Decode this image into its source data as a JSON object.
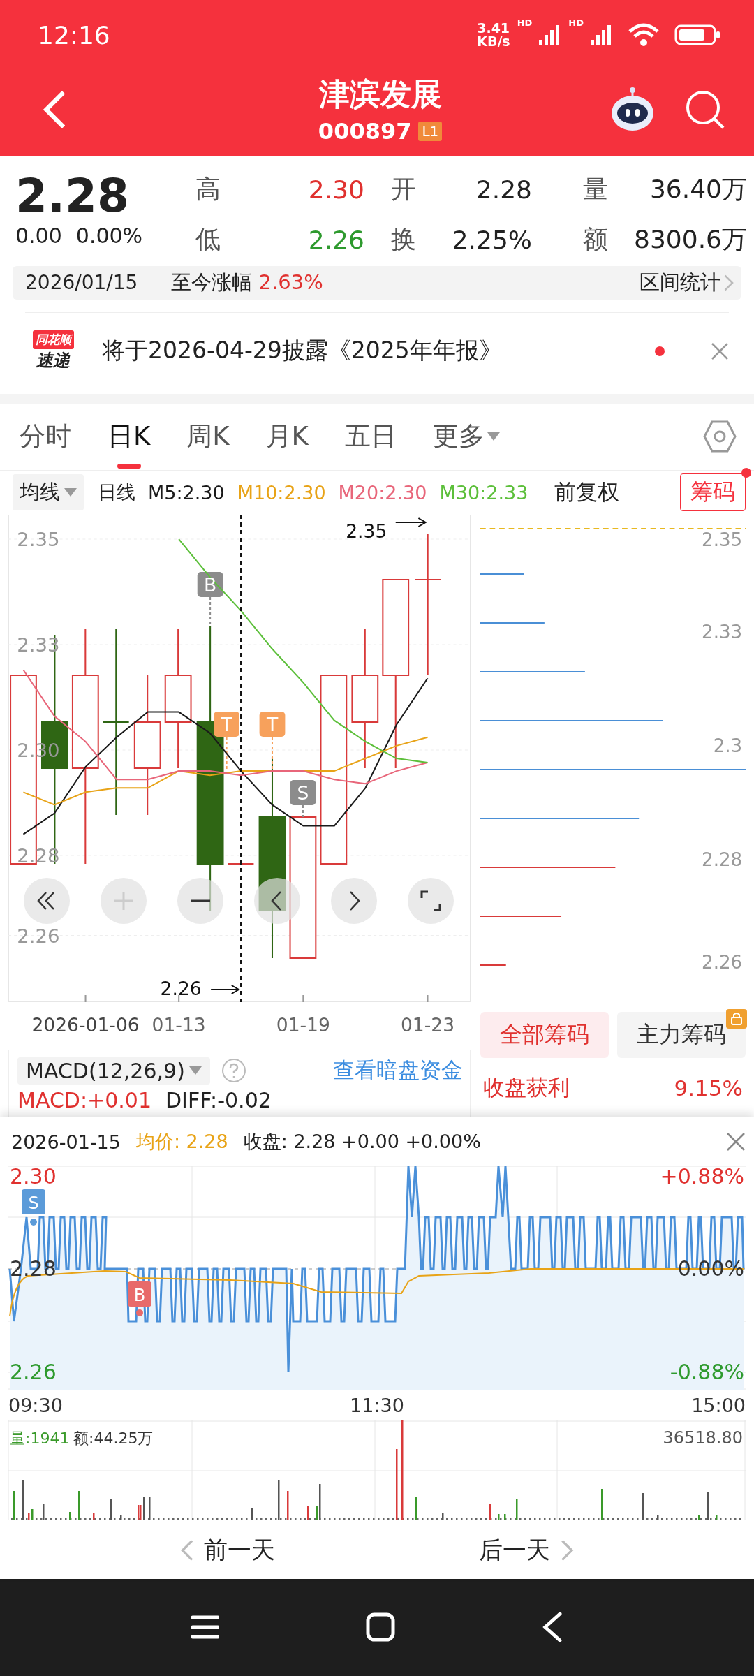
{
  "status_bar": {
    "time": "12:16",
    "speed_value": "3.41",
    "speed_unit": "KB/s",
    "signal_labels": [
      "HD",
      "HD"
    ]
  },
  "header": {
    "title": "津滨发展",
    "code": "000897",
    "level_badge": "L1"
  },
  "quote": {
    "price": "2.28",
    "change": "0.00",
    "change_pct": "0.00%",
    "stats": [
      {
        "label": "高",
        "value": "2.30",
        "color": "#e0312f"
      },
      {
        "label": "开",
        "value": "2.28",
        "color": "#222222"
      },
      {
        "label": "量",
        "value": "36.40万",
        "color": "#222222"
      },
      {
        "label": "低",
        "value": "2.26",
        "color": "#2e9a2e"
      },
      {
        "label": "换",
        "value": "2.25%",
        "color": "#222222"
      },
      {
        "label": "额",
        "value": "8300.6万",
        "color": "#222222"
      }
    ]
  },
  "range_bar": {
    "date": "2026/01/15",
    "label": "至今涨幅",
    "value": "2.63%",
    "link": "区间统计"
  },
  "notice": {
    "badge_top": "同花顺",
    "badge_bottom": "速递",
    "text": "将于2026-04-29披露《2025年年报》",
    "unread": true
  },
  "tabs": [
    {
      "label": "分时",
      "selected": false,
      "kind": "tab"
    },
    {
      "label": "日K",
      "selected": true,
      "kind": "tab"
    },
    {
      "label": "周K",
      "selected": false,
      "kind": "tab"
    },
    {
      "label": "月K",
      "selected": false,
      "kind": "tab"
    },
    {
      "label": "五日",
      "selected": false,
      "kind": "tab"
    },
    {
      "label": "更多",
      "selected": false,
      "kind": "menu"
    }
  ],
  "indicator_bar": {
    "selector": "均线",
    "period": "日线",
    "averages": [
      {
        "value": ":2.30"
      },
      {
        "value": ":2.30"
      },
      {
        "value": ":2.30"
      },
      {
        "value": ":2.33"
      }
    ],
    "adjust": "前复权",
    "chips_button": "筹码",
    "chips_new": true
  },
  "kline": {
    "chart_data": {
      "type": "line",
      "categories": [
        null,
        null,
        "2026-01-06",
        null,
        null,
        "01-13",
        null,
        null,
        null,
        "01-19",
        null,
        null,
        null,
        "01-23"
      ],
      "yticks": [
        {
          "value": 2.35,
          "label": "2.35"
        },
        {
          "value": 2.325,
          "label": "2.33"
        },
        {
          "value": 2.3,
          "label": "2.30"
        },
        {
          "value": 2.275,
          "label": "2.28"
        },
        {
          "value": 2.256,
          "label": "2.26"
        }
      ],
      "ylim": [
        2.2402,
        2.3558
      ],
      "grid": true,
      "series": [
        {
          "name": "M5",
          "color": "#1a1a1a",
          "values": [
            2.28,
            2.285,
            2.296,
            2.303,
            2.309,
            2.309,
            2.304,
            2.295,
            2.287,
            2.282,
            2.282,
            2.291,
            2.306,
            2.317
          ]
        },
        {
          "name": "M10",
          "color": "#e8a317",
          "values": [
            2.29,
            2.287,
            2.29,
            2.291,
            2.291,
            2.295,
            2.294,
            2.295,
            2.295,
            2.295,
            2.295,
            2.298,
            2.301,
            2.303
          ]
        },
        {
          "name": "M20",
          "color": "#e8667a",
          "values": [
            2.319,
            2.308,
            2.302,
            2.293,
            2.293,
            2.295,
            2.295,
            2.294,
            2.295,
            2.295,
            2.293,
            2.292,
            2.295,
            2.297
          ]
        },
        {
          "name": "M30",
          "color": "#5cbf3a",
          "values": [
            null,
            null,
            null,
            null,
            null,
            2.35,
            2.341,
            2.333,
            2.324,
            2.316,
            2.307,
            2.302,
            2.298,
            2.297
          ]
        }
      ]
    },
    "high_marker": "2.35",
    "low_marker": "2.26",
    "signals": [
      {
        "label": "B",
        "color": "#8c8c8c"
      },
      {
        "label": "T",
        "color": "#f7a15c"
      },
      {
        "label": "T",
        "color": "#f7a15c"
      },
      {
        "label": "S",
        "color": "#8c8c8c"
      }
    ]
  },
  "chips": {
    "y_labels": [
      "2.35",
      "2.33",
      "2.3",
      "2.28",
      "2.26"
    ],
    "tabs": [
      {
        "label": "全部筹码",
        "selected": true,
        "locked": false
      },
      {
        "label": "主力筹码",
        "selected": false,
        "locked": true
      }
    ],
    "profit_label": "收盘获利",
    "profit_value": "9.15%"
  },
  "macd": {
    "selector": "MACD(12,26,9)",
    "link": "查看暗盘资金",
    "macd": "MACD:+0.01",
    "diff": "DIFF:-0.02"
  },
  "intraday": {
    "date": "2026-01-15",
    "average": "均价: 2.28",
    "close": "收盘: 2.28 +0.00 +0.00%",
    "price_labels": [
      "2.30",
      "2.28",
      "2.26"
    ],
    "pct_labels": [
      "+0.88%",
      "0.00%",
      "-0.88%"
    ],
    "times": [
      "09:30",
      "11:30",
      "15:00"
    ],
    "markers": [
      {
        "label": "S",
        "color": "#5b9bd9"
      },
      {
        "label": "B",
        "color": "#e86a6a"
      }
    ],
    "volume": "量:1941",
    "amount": "额:44.25万",
    "volume_max": "36518.80"
  },
  "day_nav": {
    "prev": "前一天",
    "next": "后一天"
  }
}
